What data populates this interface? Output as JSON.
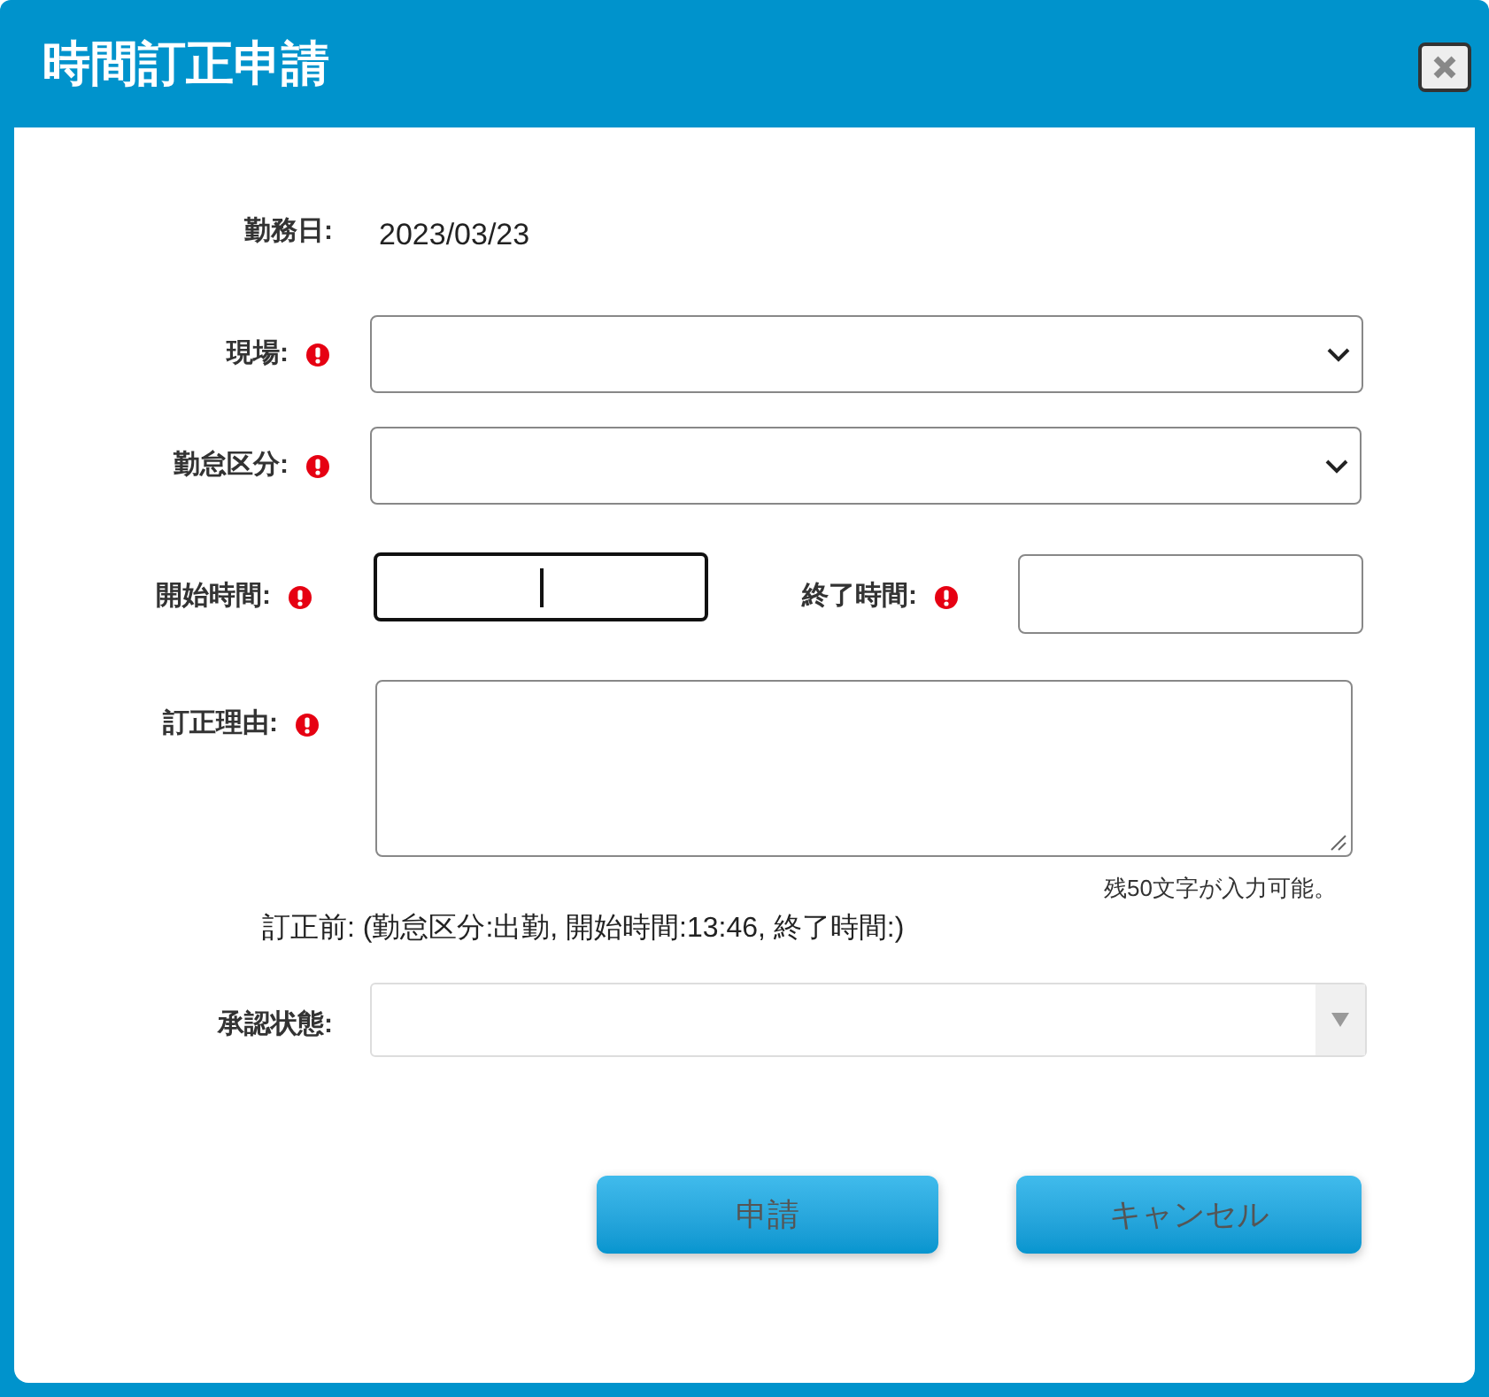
{
  "window": {
    "title": "時間訂正申請"
  },
  "work_date": {
    "label": "勤務日:",
    "value": "2023/03/23"
  },
  "site": {
    "label": "現場:",
    "required": true
  },
  "attendance_type": {
    "label": "勤怠区分:",
    "required": true
  },
  "start_time": {
    "label": "開始時間:",
    "required": true,
    "focused": true
  },
  "end_time": {
    "label": "終了時間:",
    "required": true,
    "focused": false
  },
  "reason": {
    "label": "訂正理由:",
    "required": true,
    "remaining": "残50文字が入力可能。"
  },
  "before_correction": "訂正前: (勤怠区分:出勤, 開始時間:13:46, 終了時間:)",
  "approval_status": {
    "label": "承認状態:",
    "disabled": true
  },
  "buttons": [
    "申請",
    "キャンセル"
  ]
}
